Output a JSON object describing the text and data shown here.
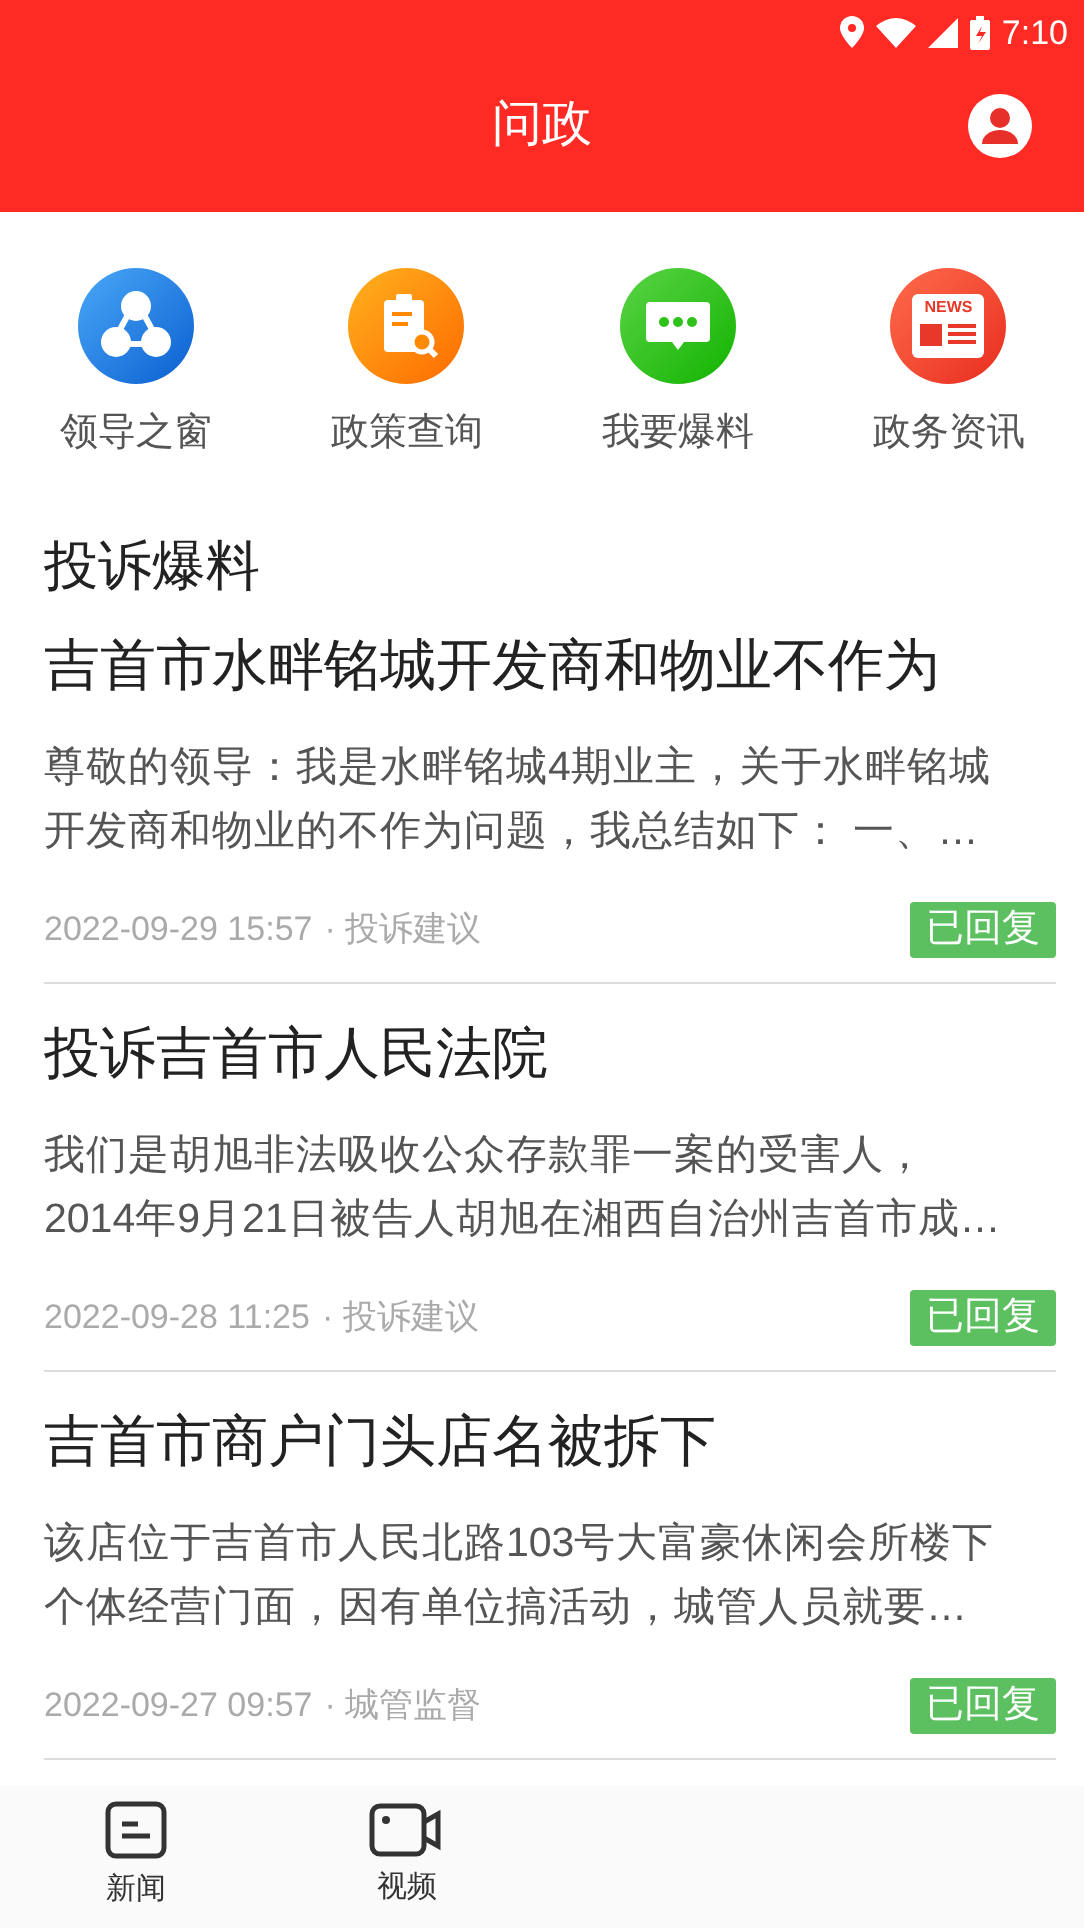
{
  "status_bar": {
    "time": "7:10"
  },
  "header": {
    "title": "问政"
  },
  "shortcuts": [
    {
      "kind": "leaders",
      "label": "领导之窗"
    },
    {
      "kind": "policy",
      "label": "政策查询"
    },
    {
      "kind": "report",
      "label": "我要爆料"
    },
    {
      "kind": "news",
      "label": "政务资讯",
      "icon_text": "NEWS"
    }
  ],
  "section_title": "投诉爆料",
  "posts": [
    {
      "title": "吉首市水畔铭城开发商和物业不作为",
      "excerpt": "尊敬的领导：我是水畔铭城4期业主，关于水畔铭城开发商和物业的不作为问题，我总结如下： 一、…",
      "date": "2022-09-29 15:57",
      "category": "· 投诉建议",
      "status": "已回复"
    },
    {
      "title": "投诉吉首市人民法院",
      "excerpt": "我们是胡旭非法吸收公众存款罪一案的受害人，2014年9月21日被告人胡旭在湘西自治州吉首市成…",
      "date": "2022-09-28 11:25",
      "category": "· 投诉建议",
      "status": "已回复"
    },
    {
      "title": "吉首市商户门头店名被拆下",
      "excerpt": "该店位于吉首市人民北路103号大富豪休闲会所楼下个体经营门面，因有单位搞活动，城管人员就要…",
      "date": "2022-09-27 09:57",
      "category": "· 城管监督",
      "status": "已回复"
    }
  ],
  "bottom_nav": [
    {
      "kind": "news",
      "label": "新闻",
      "selected": false
    },
    {
      "kind": "video",
      "label": "视频",
      "selected": false
    }
  ]
}
